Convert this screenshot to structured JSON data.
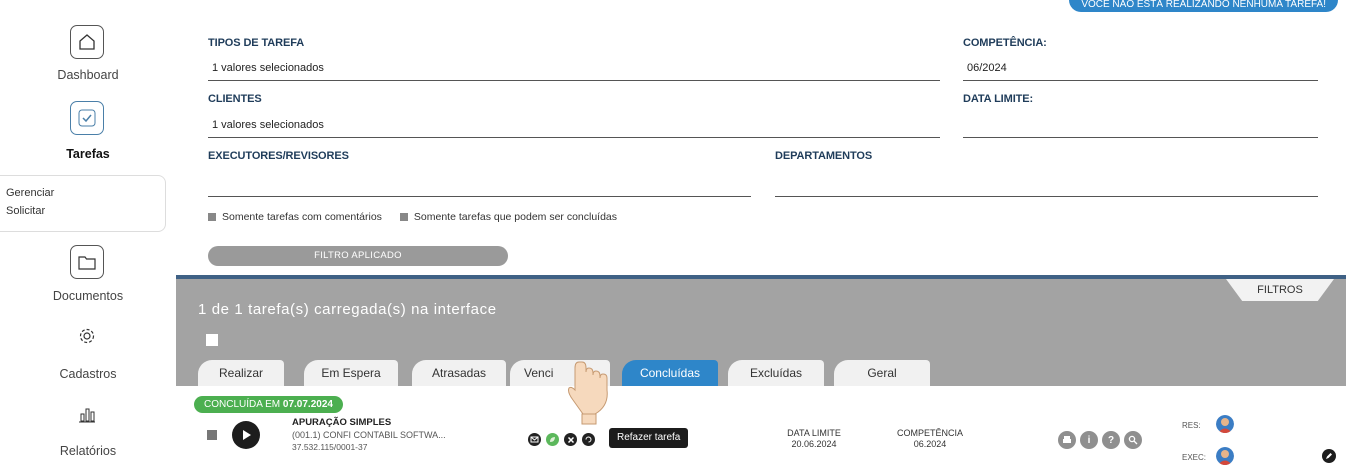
{
  "top_banner": "VOCÊ NÃO ESTÁ REALIZANDO NENHUMA TAREFA!",
  "sidebar": {
    "dashboard": "Dashboard",
    "tarefas": "Tarefas",
    "submenu": [
      "Gerenciar",
      "Solicitar"
    ],
    "documentos": "Documentos",
    "cadastros": "Cadastros",
    "relatorios": "Relatórios"
  },
  "filters": {
    "tipos_label": "TIPOS DE TAREFA",
    "tipos_value": "1 valores selecionados",
    "competencia_label": "COMPETÊNCIA:",
    "competencia_value": "06/2024",
    "clientes_label": "CLIENTES",
    "clientes_value": "1 valores selecionados",
    "data_limite_label": "DATA LIMITE:",
    "executores_label": "EXECUTORES/REVISORES",
    "departamentos_label": "DEPARTAMENTOS",
    "check_comentarios": "Somente tarefas com comentários",
    "check_concluidas": "Somente tarefas que podem ser concluídas",
    "filtro_button": "FILTRO APLICADO"
  },
  "panel": {
    "title": "1 de 1 tarefa(s) carregada(s) na interface",
    "filtros_tab": "FILTROS",
    "tabs": [
      "Realizar",
      "Em Espera",
      "Atrasadas",
      "Venci",
      "Concluídas",
      "Excluídas",
      "Geral"
    ],
    "active_tab": "Concluídas"
  },
  "task": {
    "status_prefix": "CONCLUÍDA EM",
    "status_date": "07.07.2024",
    "title": "APURAÇÃO SIMPLES",
    "client": "(001.1) CONFI CONTABIL SOFTWA...",
    "cnpj": "37.532.115/0001-37",
    "tooltip": "Refazer tarefa",
    "data_limite_label": "DATA LIMITE",
    "data_limite_value": "20.06.2024",
    "competencia_label": "COMPETÊNCIA",
    "competencia_value": "06.2024",
    "res_label": "RES:",
    "exec_label": "EXEC:"
  },
  "colors": {
    "accent": "#2e86c9",
    "panel_gray": "#a3a3a3",
    "panel_border": "#3f6185",
    "status_green": "#4caf50"
  }
}
